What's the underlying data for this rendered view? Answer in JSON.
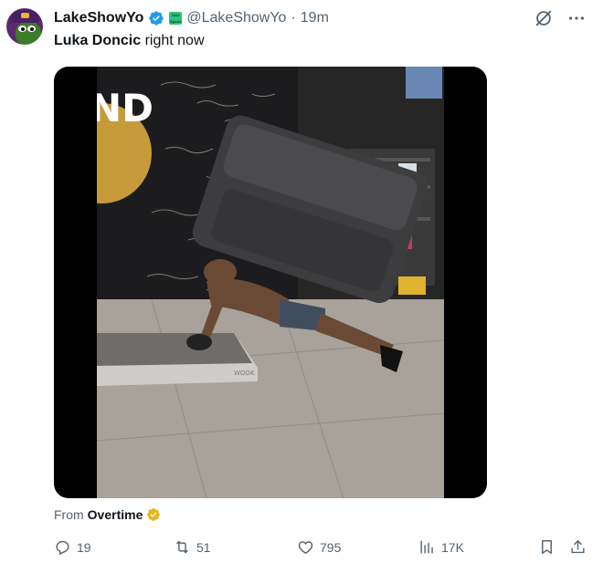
{
  "author": {
    "display_name": "LakeShowYo",
    "handle": "@LakeShowYo",
    "separator": "·",
    "time": "19m",
    "affiliate_badge_text": "Gain Sports"
  },
  "tweet": {
    "text_bold": "Luka Doncic",
    "text_rest": " right now"
  },
  "media": {
    "kind": "video",
    "wall_text": "ND",
    "treadmill_brand": "WOOK"
  },
  "source": {
    "prefix": "From",
    "name": "Overtime"
  },
  "metrics": {
    "replies": "19",
    "reposts": "51",
    "likes": "795",
    "views": "17K"
  },
  "icons": {
    "verified": "verified-badge-icon",
    "grok": "grok-icon",
    "more": "more-icon",
    "reply": "reply-icon",
    "repost": "repost-icon",
    "like": "heart-icon",
    "views": "views-chart-icon",
    "bookmark": "bookmark-icon",
    "share": "share-icon"
  },
  "colors": {
    "text": "#0f1419",
    "secondary": "#536471",
    "verified_blue": "#1d9bf0",
    "gold_badge": "#e2b719"
  }
}
